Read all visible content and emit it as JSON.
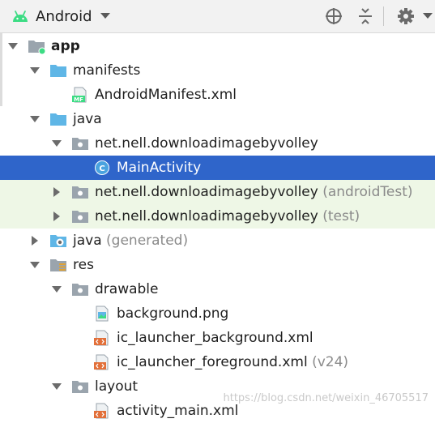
{
  "header": {
    "title": "Android",
    "icons": [
      "android-icon",
      "dropdown-caret-icon",
      "crosshair-icon",
      "collapse-all-icon",
      "gear-icon"
    ]
  },
  "tree": [
    {
      "label": "app",
      "suffix": "",
      "icon": "module-folder-icon",
      "arrow": "down",
      "depth": 0,
      "style": "normal"
    },
    {
      "label": "manifests",
      "suffix": "",
      "icon": "folder-icon",
      "arrow": "down",
      "depth": 1,
      "style": "normal"
    },
    {
      "label": "AndroidManifest.xml",
      "suffix": "",
      "icon": "manifest-file-icon",
      "arrow": "none",
      "depth": 2,
      "style": "normal"
    },
    {
      "label": "java",
      "suffix": "",
      "icon": "folder-icon",
      "arrow": "down",
      "depth": 1,
      "style": "normal"
    },
    {
      "label": "net.nell.downloadimagebyvolley",
      "suffix": "",
      "icon": "package-icon",
      "arrow": "down",
      "depth": 2,
      "style": "normal"
    },
    {
      "label": "MainActivity",
      "suffix": "",
      "icon": "class-icon",
      "arrow": "none",
      "depth": 3,
      "style": "selected"
    },
    {
      "label": "net.nell.downloadimagebyvolley",
      "suffix": "(androidTest)",
      "icon": "package-icon",
      "arrow": "right",
      "depth": 2,
      "style": "green"
    },
    {
      "label": "net.nell.downloadimagebyvolley",
      "suffix": "(test)",
      "icon": "package-icon",
      "arrow": "right",
      "depth": 2,
      "style": "green"
    },
    {
      "label": "java",
      "suffix": "(generated)",
      "icon": "generated-folder-icon",
      "arrow": "right",
      "depth": 1,
      "style": "normal"
    },
    {
      "label": "res",
      "suffix": "",
      "icon": "res-folder-icon",
      "arrow": "down",
      "depth": 1,
      "style": "normal"
    },
    {
      "label": "drawable",
      "suffix": "",
      "icon": "package-icon",
      "arrow": "down",
      "depth": 2,
      "style": "normal"
    },
    {
      "label": "background.png",
      "suffix": "",
      "icon": "image-file-icon",
      "arrow": "none",
      "depth": 3,
      "style": "normal"
    },
    {
      "label": "ic_launcher_background.xml",
      "suffix": "",
      "icon": "xml-file-icon",
      "arrow": "none",
      "depth": 3,
      "style": "normal"
    },
    {
      "label": "ic_launcher_foreground.xml",
      "suffix": "(v24)",
      "icon": "xml-file-icon",
      "arrow": "none",
      "depth": 3,
      "style": "normal"
    },
    {
      "label": "layout",
      "suffix": "",
      "icon": "package-icon",
      "arrow": "down",
      "depth": 2,
      "style": "normal"
    },
    {
      "label": "activity_main.xml",
      "suffix": "",
      "icon": "xml-file-icon",
      "arrow": "none",
      "depth": 3,
      "style": "normal"
    }
  ],
  "watermark": "https://blog.csdn.net/weixin_46705517",
  "colors": {
    "selected": "#2f65ca",
    "green_row": "#eef7e6",
    "folder": "#5fb6e6",
    "android": "#3ddc84"
  }
}
